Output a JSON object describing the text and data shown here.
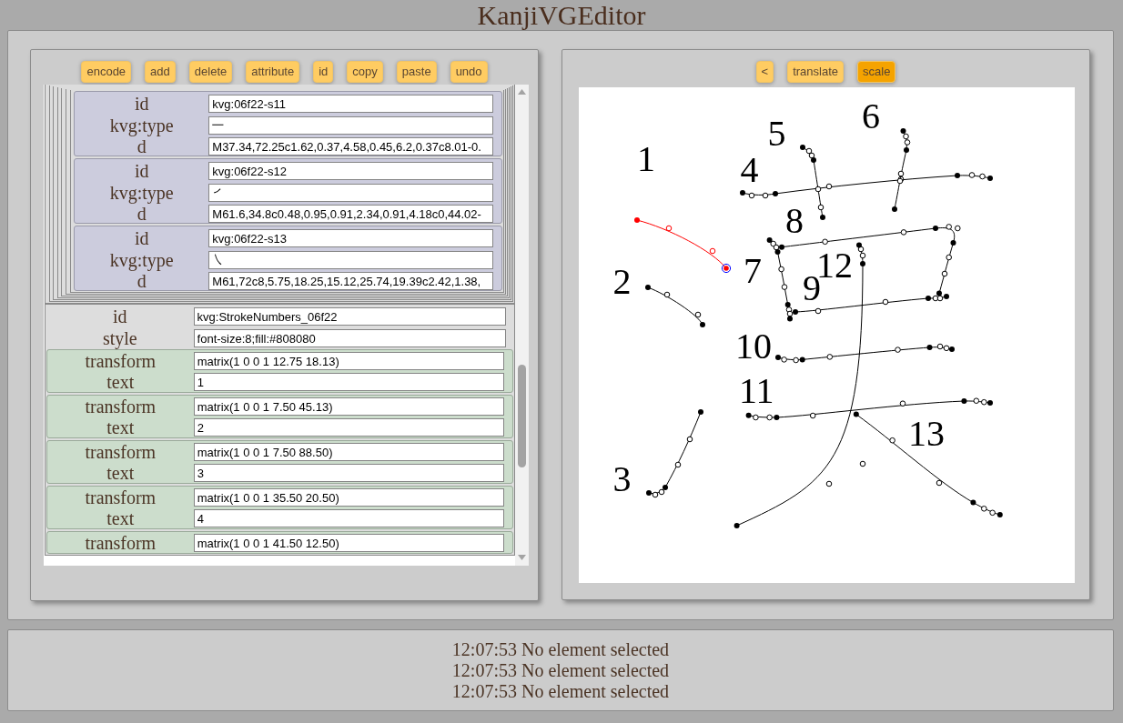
{
  "title": "KanjiVGEditor",
  "tree_toolbar": [
    "encode",
    "add",
    "delete",
    "attribute",
    "id",
    "copy",
    "paste",
    "undo"
  ],
  "tree": [
    {
      "kind": "group",
      "children": [
        {
          "kind": "group",
          "children": [
            {
              "kind": "group",
              "children": [
                {
                  "kind": "group",
                  "children": [
                    {
                      "kind": "group",
                      "children": [
                        {
                          "kind": "group",
                          "children": [
                            {
                              "kind": "group",
                              "children": [
                                {
                                  "kind": "path",
                                  "attributes": [
                                    {
                                      "name": "id",
                                      "value": "kvg:06f22-s11"
                                    },
                                    {
                                      "name": "kvg:type",
                                      "value": "㇐"
                                    },
                                    {
                                      "name": "d",
                                      "value": "M37.34,72.25c1.62,0.37,4.58,0.45,6.2,0.37c8.01-0."
                                    }
                                  ]
                                },
                                {
                                  "kind": "path",
                                  "attributes": [
                                    {
                                      "name": "id",
                                      "value": "kvg:06f22-s12"
                                    },
                                    {
                                      "name": "kvg:type",
                                      "value": "㇒"
                                    },
                                    {
                                      "name": "d",
                                      "value": "M61.6,34.8c0.48,0.95,0.91,2.34,0.91,4.18c0,44.02-"
                                    }
                                  ]
                                },
                                {
                                  "kind": "path",
                                  "attributes": [
                                    {
                                      "name": "id",
                                      "value": "kvg:06f22-s13"
                                    },
                                    {
                                      "name": "kvg:type",
                                      "value": "㇏"
                                    },
                                    {
                                      "name": "d",
                                      "value": "M61,72c8,5.75,18.25,15.12,25.74,19.39c2.42,1.38,"
                                    }
                                  ]
                                }
                              ]
                            }
                          ]
                        }
                      ]
                    }
                  ]
                }
              ]
            }
          ]
        }
      ]
    },
    {
      "kind": "group",
      "attributes": [
        {
          "name": "id",
          "value": "kvg:StrokeNumbers_06f22"
        },
        {
          "name": "style",
          "value": "font-size:8;fill:#808080"
        }
      ],
      "children": [
        {
          "kind": "text",
          "attributes": [
            {
              "name": "transform",
              "value": "matrix(1 0 0 1 12.75 18.13)"
            },
            {
              "name": "text",
              "value": "1"
            }
          ]
        },
        {
          "kind": "text",
          "attributes": [
            {
              "name": "transform",
              "value": "matrix(1 0 0 1 7.50 45.13)"
            },
            {
              "name": "text",
              "value": "2"
            }
          ]
        },
        {
          "kind": "text",
          "attributes": [
            {
              "name": "transform",
              "value": "matrix(1 0 0 1 7.50 88.50)"
            },
            {
              "name": "text",
              "value": "3"
            }
          ]
        },
        {
          "kind": "text",
          "attributes": [
            {
              "name": "transform",
              "value": "matrix(1 0 0 1 35.50 20.50)"
            },
            {
              "name": "text",
              "value": "4"
            }
          ]
        },
        {
          "kind": "text",
          "attributes": [
            {
              "name": "transform",
              "value": "matrix(1 0 0 1 41.50 12.50)"
            }
          ]
        }
      ]
    }
  ],
  "canvas_toolbar": [
    {
      "label": "<",
      "selected": false
    },
    {
      "label": "translate",
      "selected": false
    },
    {
      "label": "scale",
      "selected": true
    }
  ],
  "canvas": {
    "strokes": [
      {
        "number": "1",
        "selected": true
      },
      {
        "number": "2",
        "selected": false
      },
      {
        "number": "3",
        "selected": false
      },
      {
        "number": "4",
        "selected": false
      },
      {
        "number": "5",
        "selected": false
      },
      {
        "number": "6",
        "selected": false
      },
      {
        "number": "7",
        "selected": false
      },
      {
        "number": "8",
        "selected": false
      },
      {
        "number": "9",
        "selected": false
      },
      {
        "number": "10",
        "selected": false
      },
      {
        "number": "11",
        "selected": false
      },
      {
        "number": "12",
        "selected": false
      },
      {
        "number": "13",
        "selected": false
      }
    ]
  },
  "log": [
    "12:07:53 No element selected",
    "12:07:53 No element selected",
    "12:07:53 No element selected"
  ]
}
